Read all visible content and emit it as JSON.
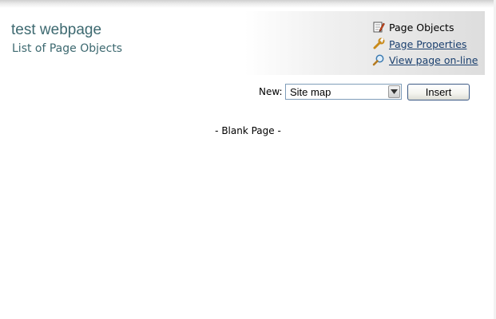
{
  "header": {
    "title": "test webpage",
    "subtitle": "List of Page Objects"
  },
  "nav": {
    "current": {
      "label": "Page Objects",
      "icon": "edit-document-icon"
    },
    "properties": {
      "label": "Page Properties",
      "icon": "wrench-icon"
    },
    "view_online": {
      "label": "View page on-line",
      "icon": "magnifier-icon"
    }
  },
  "toolbar": {
    "new_label": "New:",
    "selected_type": "Site map",
    "insert_label": "Insert"
  },
  "content": {
    "blank_note": "- Blank Page -"
  },
  "colors": {
    "title": "#3d6970",
    "link": "#1a3f6e"
  }
}
